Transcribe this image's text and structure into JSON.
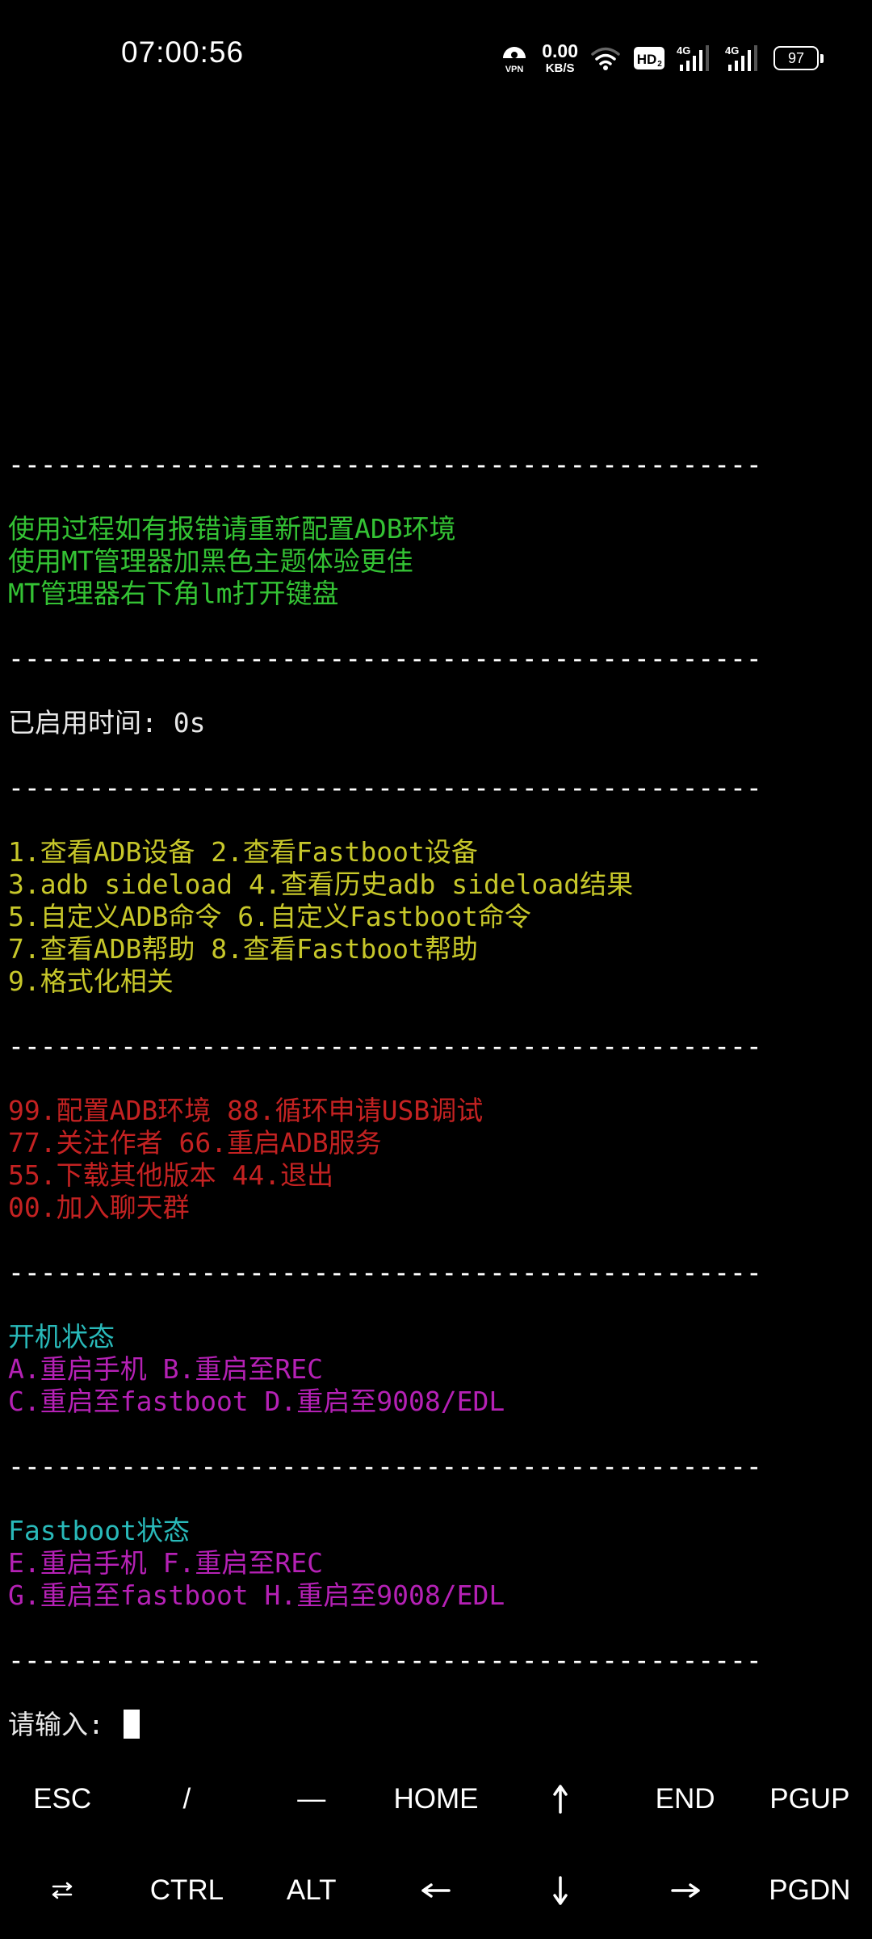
{
  "status_bar": {
    "time": "07:00:56",
    "vpn_label": "VPN",
    "speed_value": "0.00",
    "speed_unit": "KB/S",
    "hd_label": "HD",
    "network_1": "4G",
    "network_2": "4G",
    "battery": "97",
    "icons": [
      "vpn-icon",
      "wifi-icon",
      "hd-icon",
      "signal-icon",
      "signal-icon",
      "battery-icon"
    ]
  },
  "terminal": {
    "separator": "-----------------------------------------------",
    "notes": [
      "使用过程如有报错请重新配置ADB环境",
      "使用MT管理器加黑色主题体验更佳",
      "MT管理器右下角lm打开键盘"
    ],
    "uptime": "已启用时间: 0s",
    "menu_main": [
      "1.查看ADB设备 2.查看Fastboot设备",
      "3.adb sideload 4.查看历史adb sideload结果",
      "5.自定义ADB命令 6.自定义Fastboot命令",
      "7.查看ADB帮助 8.查看Fastboot帮助",
      "9.格式化相关"
    ],
    "menu_extra": [
      "99.配置ADB环境 88.循环申请USB调试",
      "77.关注作者 66.重启ADB服务",
      "55.下载其他版本 44.退出",
      "00.加入聊天群"
    ],
    "boot_title": "开机状态",
    "boot_options": [
      "A.重启手机 B.重启至REC",
      "C.重启至fastboot D.重启至9008/EDL"
    ],
    "fastboot_title": "Fastboot状态",
    "fastboot_options": [
      "E.重启手机 F.重启至REC",
      "G.重启至fastboot H.重启至9008/EDL"
    ],
    "prompt": "请输入: "
  },
  "extra_keys": {
    "row1": {
      "esc": "ESC",
      "slash": "/",
      "dash": "—",
      "home": "HOME",
      "up": "up-arrow-icon",
      "end": "END",
      "pgup": "PGUP"
    },
    "row2": {
      "tab": "tab-icon",
      "ctrl": "CTRL",
      "alt": "ALT",
      "left": "left-arrow-icon",
      "down": "down-arrow-icon",
      "right": "right-arrow-icon",
      "pgdn": "PGDN"
    }
  },
  "colors": {
    "background": "#000000",
    "green": "#34c234",
    "yellow": "#c7c72a",
    "red": "#c42222",
    "cyan": "#29b9b9",
    "magenta": "#b521b5"
  }
}
